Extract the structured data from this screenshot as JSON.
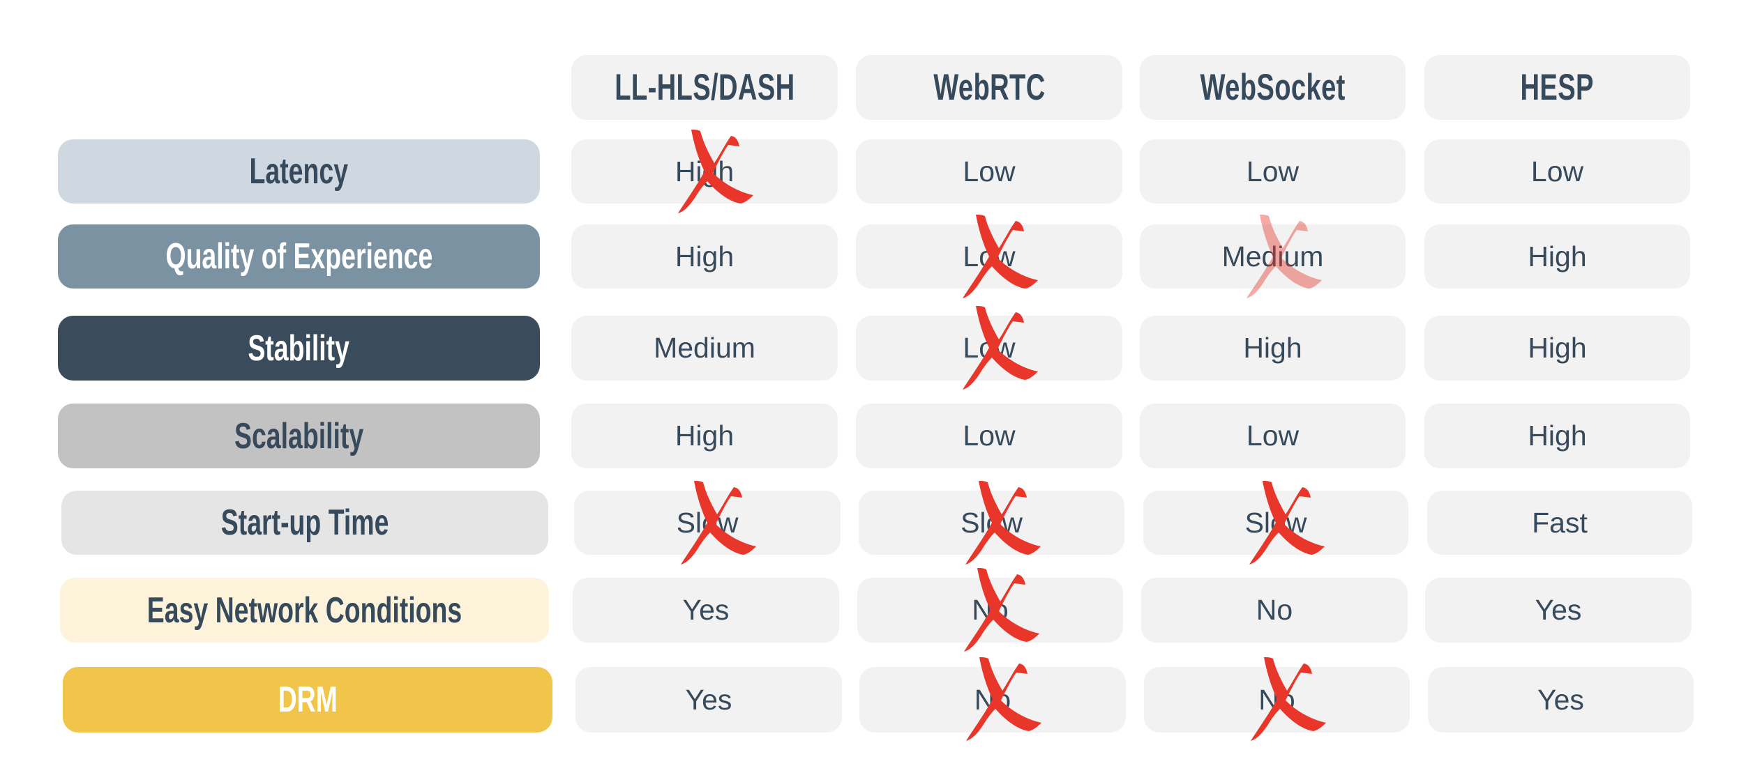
{
  "columns": [
    "LL-HLS/DASH",
    "WebRTC",
    "WebSocket",
    "HESP"
  ],
  "rows": [
    {
      "label": "Latency",
      "bg": "#cfd8e0",
      "text_color": "dark",
      "values": [
        "High",
        "Low",
        "Low",
        "Low"
      ],
      "crossed": [
        "full",
        "none",
        "none",
        "none"
      ]
    },
    {
      "label": "Quality of Experience",
      "bg": "#7a92a1",
      "text_color": "light",
      "values": [
        "High",
        "Low",
        "Medium",
        "High"
      ],
      "crossed": [
        "none",
        "full",
        "faded",
        "none"
      ]
    },
    {
      "label": "Stability",
      "bg": "#3a4b5c",
      "text_color": "light",
      "values": [
        "Medium",
        "Low",
        "High",
        "High"
      ],
      "crossed": [
        "none",
        "full",
        "none",
        "none"
      ]
    },
    {
      "label": "Scalability",
      "bg": "#c2c2c2",
      "text_color": "dark",
      "values": [
        "High",
        "Low",
        "Low",
        "High"
      ],
      "crossed": [
        "none",
        "none",
        "none",
        "none"
      ]
    },
    {
      "label": "Start-up Time",
      "bg": "#e5e5e5",
      "text_color": "dark",
      "values": [
        "Slow",
        "Slow",
        "Slow",
        "Fast"
      ],
      "crossed": [
        "full",
        "full",
        "full",
        "none"
      ]
    },
    {
      "label": "Easy Network Conditions",
      "bg": "#fdf3da",
      "text_color": "dark",
      "values": [
        "Yes",
        "No",
        "No",
        "Yes"
      ],
      "crossed": [
        "none",
        "full",
        "none",
        "none"
      ]
    },
    {
      "label": "DRM",
      "bg": "#f0c54a",
      "text_color": "light",
      "values": [
        "Yes",
        "No",
        "No",
        "Yes"
      ],
      "crossed": [
        "none",
        "full",
        "full",
        "none"
      ]
    }
  ],
  "colors": {
    "text": "#374a5c",
    "cell_bg": "#f2f2f2",
    "cross": "#e8372a"
  },
  "icons": {
    "cross": "red-x-mark-icon"
  }
}
